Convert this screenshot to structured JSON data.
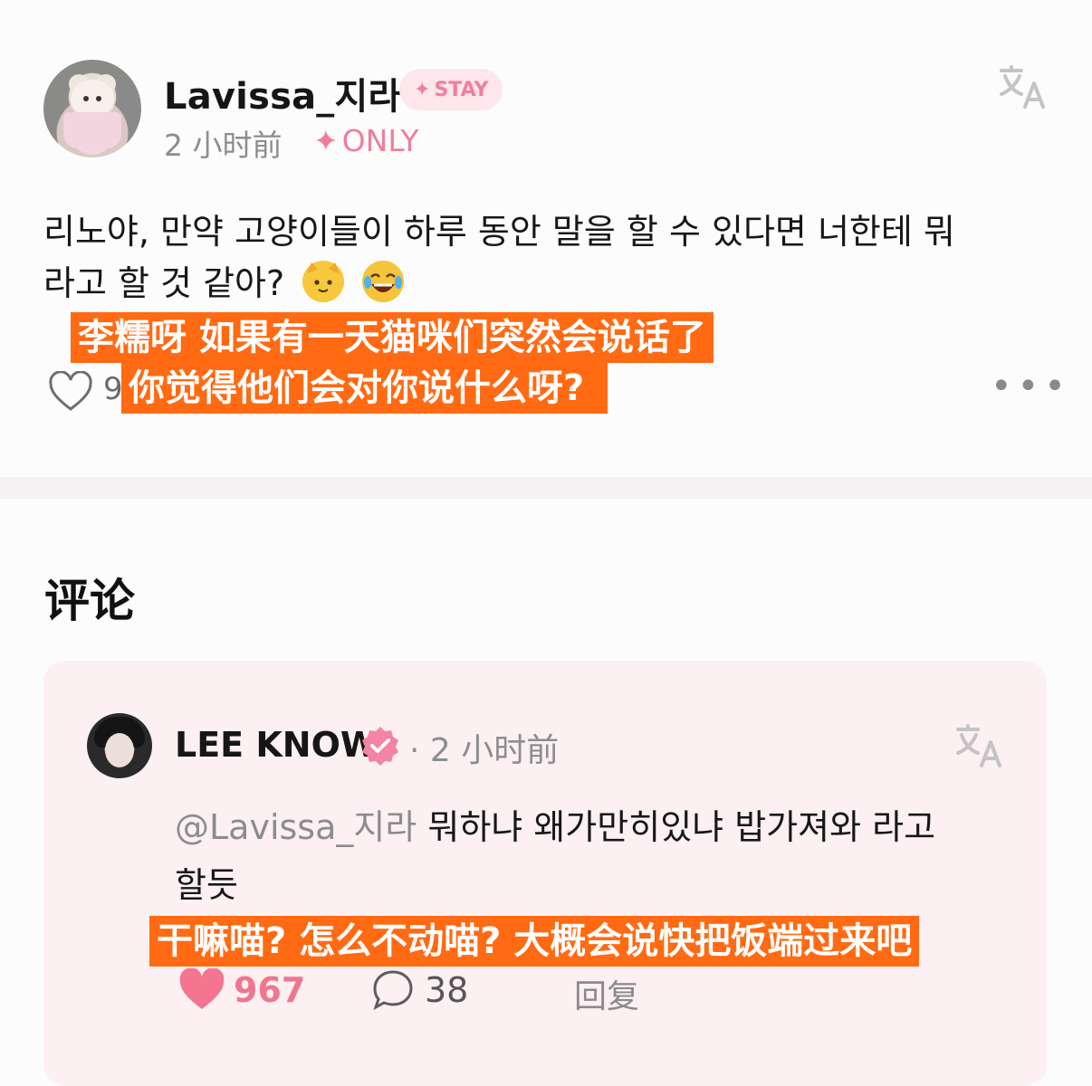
{
  "post": {
    "username": "Lavissa_지라",
    "badge": "STAY",
    "badge_star": "✦",
    "time": "2 小时前",
    "tag_star": "✦",
    "tag": "ONLY",
    "text_line1": "리노야, 만약 고양이들이 하루 동안 말을 할 수 있다면 너한테 뭐",
    "text_line2": "라고 할 것 같아?",
    "emoji1": "cat-face",
    "emoji2": "tears-of-joy",
    "like_count_partial": "9",
    "more": "•••",
    "subtitle_line1": "李糯呀 如果有一天猫咪们突然会说话了",
    "subtitle_line2": "你觉得他们会对你说什么呀?"
  },
  "comments_section": {
    "title": "评论"
  },
  "comment": {
    "username": "LEE KNOW",
    "separator": "·",
    "time": "2 小时前",
    "mention": "@Lavissa_지라",
    "text_line1": " 뭐하냐 왜가만히있냐 밥가져와 라고",
    "text_line2": "할듯",
    "subtitle": "干嘛喵? 怎么不动喵? 大概会说快把饭端过来吧",
    "likes": "967",
    "replies": "38",
    "reply_label": "回复"
  },
  "colors": {
    "accent_pink": "#f0768f",
    "subtitle_bg": "#ff6a13",
    "card_bg": "#fdf0f3"
  }
}
